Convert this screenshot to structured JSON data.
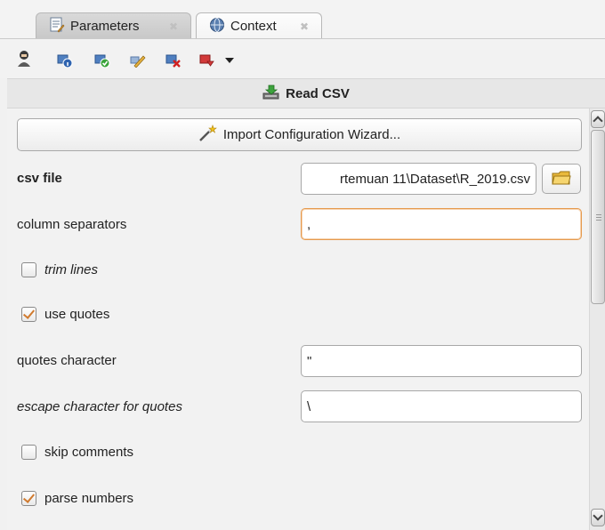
{
  "tabs": [
    {
      "label": "Parameters",
      "icon": "parameters-icon",
      "close_icon": "close-icon"
    },
    {
      "label": "Context",
      "icon": "globe-icon",
      "close_icon": "close-icon"
    }
  ],
  "toolbar": {
    "icons": [
      "user-icon",
      "info-icon",
      "check-icon",
      "pencil-icon",
      "delete-icon",
      "red-dropdown-icon"
    ],
    "dropdown_icon": "chevron-down-icon"
  },
  "operator": {
    "title": "Read CSV",
    "icon": "read-csv-icon"
  },
  "wizard_button": {
    "label": "Import Configuration Wizard...",
    "icon": "wand-icon"
  },
  "fields": {
    "csv_file": {
      "label": "csv file",
      "value": "rtemuan 11\\Dataset\\R_2019.csv",
      "button_icon": "folder-icon"
    },
    "column_separators": {
      "label": "column separators",
      "value": ","
    },
    "quotes_character": {
      "label": "quotes character",
      "value": "\""
    },
    "escape_character": {
      "label": "escape character for quotes",
      "value": "\\"
    }
  },
  "checkboxes": {
    "trim_lines": {
      "label": "trim lines",
      "checked": false
    },
    "use_quotes": {
      "label": "use quotes",
      "checked": true
    },
    "skip_comments": {
      "label": "skip comments",
      "checked": false
    },
    "parse_numbers": {
      "label": "parse numbers",
      "checked": true
    }
  },
  "colors": {
    "focus_border": "#e69a4e",
    "check_mark": "#d07a2e",
    "panel_bg": "#f2f2f2"
  }
}
